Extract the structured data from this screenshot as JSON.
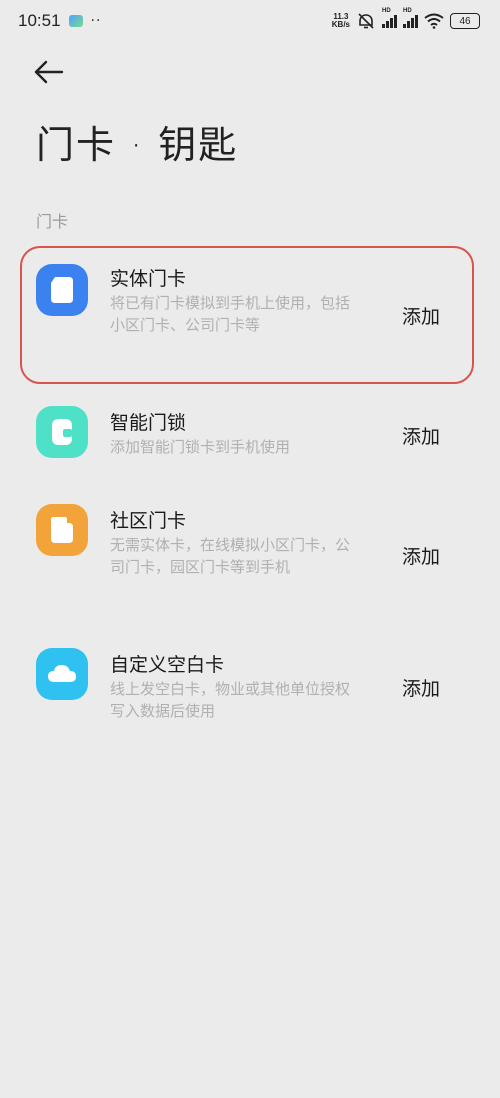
{
  "status_bar": {
    "time": "10:51",
    "dots": "··",
    "net_speed_value": "11.3",
    "net_speed_unit": "KB/s",
    "hd1": "HD",
    "hd2": "HD",
    "battery": "46"
  },
  "header": {
    "title": "门卡 · 钥匙"
  },
  "section": {
    "label": "门卡"
  },
  "items": [
    {
      "title": "实体门卡",
      "desc": "将已有门卡模拟到手机上使用，包括小区门卡、公司门卡等",
      "action": "添加",
      "color": "#3b82f0"
    },
    {
      "title": "智能门锁",
      "desc": "添加智能门锁卡到手机使用",
      "action": "添加",
      "color": "#4fe0c8"
    },
    {
      "title": "社区门卡",
      "desc": "无需实体卡，在线模拟小区门卡，公司门卡，园区门卡等到手机",
      "action": "添加",
      "color": "#f2a33a"
    },
    {
      "title": "自定义空白卡",
      "desc": "线上发空白卡，物业或其他单位授权写入数据后使用",
      "action": "添加",
      "color": "#2fc1f0"
    }
  ]
}
